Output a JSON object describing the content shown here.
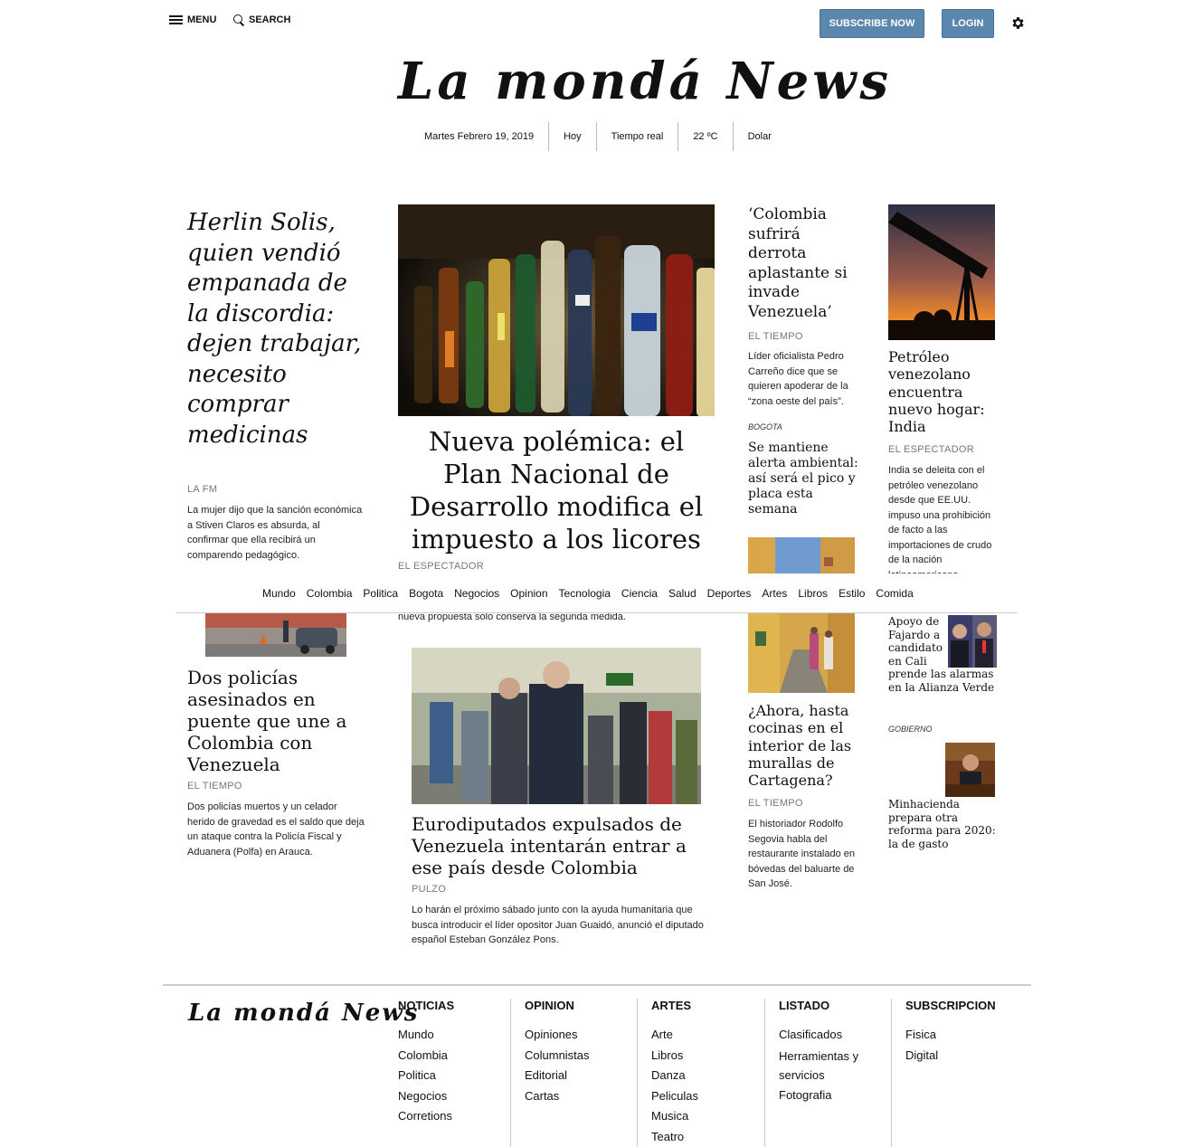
{
  "header": {
    "menu_label": "MENU",
    "search_label": "SEARCH",
    "subscribe_label": "SUBSCRIBE NOW",
    "login_label": "LOGIN",
    "brand": "La mondá News",
    "accent_color": "#5b86ad"
  },
  "infobar": {
    "date": "Martes Febrero 19, 2019",
    "today": "Hoy",
    "realtime": "Tiempo real",
    "temperature": "22 ºC",
    "currency": "Dolar"
  },
  "nav": [
    "Mundo",
    "Colombia",
    "Politica",
    "Bogota",
    "Negocios",
    "Opinion",
    "Tecnologia",
    "Ciencia",
    "Salud",
    "Deportes",
    "Artes",
    "Libros",
    "Estilo",
    "Comida"
  ],
  "stories": {
    "herlin": {
      "headline": "Herlin Solis, quien vendió empanada de la discordia: dejen trabajar, necesito comprar medicinas",
      "source": "LA FM",
      "dek": "La mujer dijo que la sanción económica a Stiven Claros es absurda, al confirmar que ella recibirá un comparendo pedagógico."
    },
    "plan": {
      "headline": "Nueva polémica: el Plan Nacional de Desarrollo modifica el impuesto a los licores",
      "source": "EL ESPECTADOR",
      "dek_tail": "nueva propuesta solo conserva la segunda medida."
    },
    "colombia": {
      "headline": "‘Colombia sufrirá derrota aplastante si invade Venezuela’",
      "source": "EL TIEMPO",
      "dek": "Líder oficialista Pedro Carreño dice que se quieren apoderar de la “zona oeste del país”."
    },
    "alerta": {
      "kicker": "BOGOTA",
      "headline": "Se mantiene alerta ambiental: así será el pico y placa esta semana"
    },
    "petroleo": {
      "headline": "Petróleo venezolano encuentra nuevo hogar: India",
      "source": "EL ESPECTADOR",
      "dek": "India se deleita con el petróleo venezolano desde que EE.UU. impuso una prohibición de facto a las importaciones de crudo de la nación latinoamericana."
    },
    "policias": {
      "headline": "Dos policías asesinados en puente que une a Colombia con Venezuela",
      "source": "EL TIEMPO",
      "dek": "Dos policías muertos y un celador herido de gravedad es el saldo que deja un ataque contra la Policía Fiscal y Aduanera (Polfa) en Arauca."
    },
    "eurodiputados": {
      "headline": "Eurodiputados expulsados de Venezuela intentarán entrar a ese país desde Colombia",
      "source": "PULZO",
      "dek": "Lo harán el próximo sábado junto con la ayuda humanitaria que busca introducir el líder opositor Juan Guaidó, anunció el diputado español Esteban González Pons."
    },
    "cartagena": {
      "headline": "¿Ahora, hasta cocinas en el interior de las murallas de Cartagena?",
      "source": "EL TIEMPO",
      "dek": "El historiador Rodolfo Segovia habla del restaurante instalado en bóvedas del baluarte de San José."
    },
    "fajardo": {
      "headline": "Apoyo de Fajardo a candidato en Cali prende las alarmas en la Alianza Verde"
    },
    "minhacienda": {
      "kicker": "GOBIERNO",
      "headline": "Minhacienda prepara otra reforma para 2020: la de gasto"
    }
  },
  "footer": {
    "brand": "La mondá News",
    "columns": [
      {
        "title": "NOTICIAS",
        "links": [
          "Mundo",
          "Colombia",
          "Politica",
          "Negocios",
          "Corretions"
        ]
      },
      {
        "title": "OPINION",
        "links": [
          "Opiniones",
          "Columnistas",
          "Editorial",
          "Cartas"
        ]
      },
      {
        "title": "ARTES",
        "links": [
          "Arte",
          "Libros",
          "Danza",
          "Peliculas",
          "Musica",
          "Teatro"
        ]
      },
      {
        "title": "LISTADO",
        "links": [
          "Clasificados",
          "Herramientas y servicios",
          "Fotografia"
        ]
      },
      {
        "title": "SUBSCRIPCION",
        "links": [
          "Fisica",
          "Digital"
        ]
      }
    ]
  }
}
